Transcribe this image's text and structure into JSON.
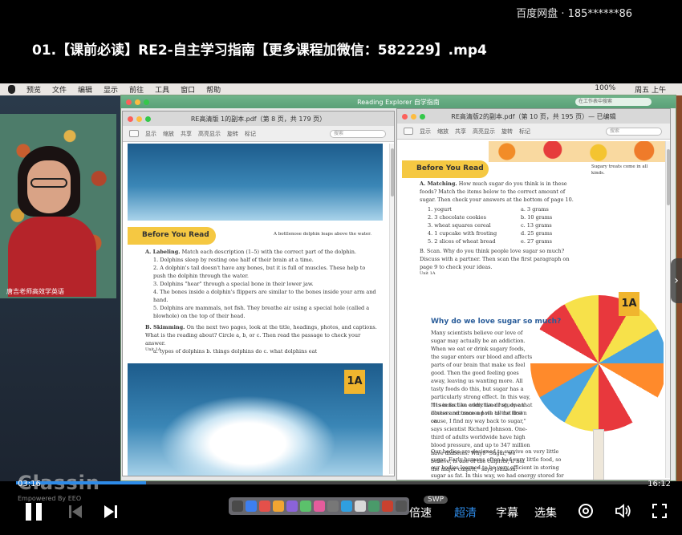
{
  "player": {
    "account": "百度网盘 · 185******86",
    "title": "01.【课前必读】RE2-自主学习指南【更多课程加微信：582229】.mp4",
    "current_time": "03:16",
    "total_time": "16:12",
    "progress_fraction": 0.2,
    "watermark": "Classin",
    "watermark_sub": "Empowered By EEO",
    "controls": {
      "speed": "倍速",
      "quality": "超清",
      "subtitle": "字幕",
      "episodes": "选集",
      "swp_badge": "SWP"
    }
  },
  "mac": {
    "menu": [
      "预览",
      "文件",
      "编辑",
      "显示",
      "前往",
      "工具",
      "窗口",
      "帮助"
    ],
    "status_right": [
      "100%",
      "周五 上午"
    ]
  },
  "webcam": {
    "label": "唐吉老师高效学英语"
  },
  "main_window": {
    "title": "Reading Explorer 自学指南",
    "search_placeholder": "在工作表中搜索"
  },
  "doc_left": {
    "title": "RE高清版 1的副本.pdf（第 8 页，共 179 页）",
    "toolbar": [
      "显示",
      "缩放",
      "共享",
      "高亮显示",
      "旋转",
      "标记",
      "搜索"
    ],
    "section": "Before You Read",
    "caption": "A bottlenose dolphin leaps above the water.",
    "labeling_head": "A. Labeling.",
    "labeling_intro": "Match each description (1–5) with the correct part of the dolphin.",
    "items": [
      "1. Dolphins sleep by resting one half of their brain at a time.",
      "2. A dolphin's tail doesn't have any bones, but it is full of muscles. These help to push the dolphin through the water.",
      "3. Dolphins \"hear\" through a special bone in their lower jaw.",
      "4. The bones inside a dolphin's flippers are similar to the bones inside your arm and hand.",
      "5. Dolphins are mammals, not fish. They breathe air using a special hole (called a blowhole) on the top of their head."
    ],
    "skimming_head": "B. Skimming.",
    "skimming": "On the next two pages, look at the title, headings, photos, and captions. What is the reading about? Circle a, b, or c. Then read the passage to check your answer.",
    "options": "a. types of dolphins    b. things dolphins do    c. what dolphins eat",
    "footer": "Unit 1A",
    "badge": "1A"
  },
  "doc_right": {
    "title": "RE高清版2的副本.pdf（第 10 页，共 195 页）— 已编辑",
    "toolbar": [
      "显示",
      "缩放",
      "共享",
      "高亮显示",
      "旋转",
      "标记",
      "搜索"
    ],
    "section": "Before You Read",
    "sugar_note": "Sugary treats come in all kinds.",
    "matching_head": "A. Matching.",
    "matching_intro": "How much sugar do you think is in these foods? Match the items below to the correct amount of sugar. Then check your answers at the bottom of page 10.",
    "foods": [
      "1. yogurt",
      "2. 3 chocolate cookies",
      "3. wheat squares cereal",
      "4. 1 cupcake with frosting",
      "5. 2 slices of wheat bread"
    ],
    "amounts": [
      "a. 3 grams",
      "b. 10 grams",
      "c. 13 grams",
      "d. 25 grams",
      "e. 27 grams"
    ],
    "scan": "B. Scan. Why do you think people love sugar so much? Discuss with a partner. Then scan the first paragraph on page 9 to check your ideas.",
    "footer": "Unit 1A",
    "article_title": "Why do we love sugar so much?",
    "para1": "Many scientists believe our love of sugar may actually be an addiction. When we eat or drink sugary foods, the sugar enters our blood and affects parts of our brain that make us feel good. Then the good feeling goes away, leaving us wanting more. All tasty foods do this, but sugar has a particularly strong effect. In this way, it is in fact an addictive drug, one that doctors recommend we all cut down on.",
    "para2": "\"It seems like every time I study an illness and trace a path to the first cause, I find my way back to sugar,\" says scientist Richard Johnson. One-third of adults worldwide have high blood pressure, and up to 347 million have diabetes. Why? \"Sugar, we believe, is one of the culprits, if not the major culprit,\" says Johnson.",
    "para3": "Our bodies are designed to survive on very little sugar. Early humans often had very little food, so our bodies learned to be very efficient in storing sugar as fat. In this way, we had energy stored for when there was no food. But today, most people have more than enough.",
    "badge": "1A"
  }
}
